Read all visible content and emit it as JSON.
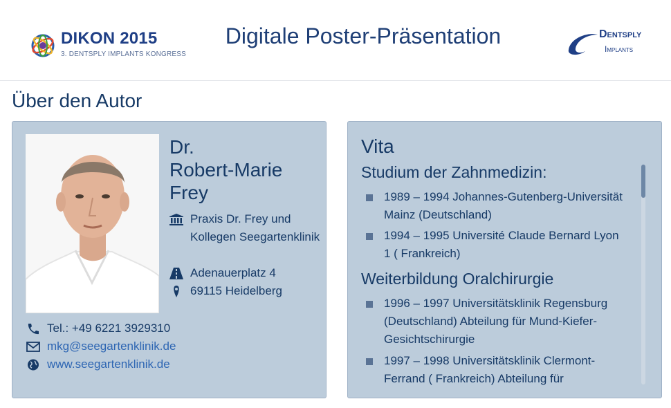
{
  "header": {
    "logo_title": "DIKON 2015",
    "logo_subtitle": "3. DENTSPLY IMPLANTS KONGRESS",
    "title": "Digitale Poster-Präsentation",
    "brand_main": "Dentsply",
    "brand_sub": "Implants"
  },
  "section": {
    "title": "Über den Autor"
  },
  "author": {
    "name_line1": "Dr.",
    "name_line2": "Robert-Marie",
    "name_line3": "Frey",
    "practice": "Praxis Dr. Frey und Kollegen Seegartenklinik",
    "street": "Adenauerplatz 4",
    "city": "69115 Heidelberg",
    "phone": "Tel.: +49 6221 3929310",
    "email": "mkg@seegartenklinik.de",
    "website": "www.seegartenklinik.de",
    "icons": [
      "building-icon",
      "road-icon",
      "map-marker-icon",
      "phone-icon",
      "envelope-icon",
      "globe-icon"
    ]
  },
  "vita": {
    "title": "Vita",
    "sections": [
      {
        "heading": "Studium der Zahnmedizin:",
        "items": [
          "1989 – 1994 Johannes-Gutenberg-Universität Mainz (Deutschland)",
          "1994 – 1995 Université Claude Bernard Lyon 1 ( Frankreich)"
        ]
      },
      {
        "heading": "Weiterbildung Oralchirurgie",
        "items": [
          "1996 – 1997 Universitätsklinik Regensburg (Deutschland) Abteilung für Mund-Kiefer-Gesichtschirurgie",
          "1997 – 1998 Universitätsklinik Clermont-Ferrand ( Frankreich) Abteilung für"
        ]
      }
    ]
  },
  "colors": {
    "card_background": "#bcccdb",
    "heading_text": "#173a66",
    "link": "#2e66b3",
    "bullet": "#5a7395"
  }
}
